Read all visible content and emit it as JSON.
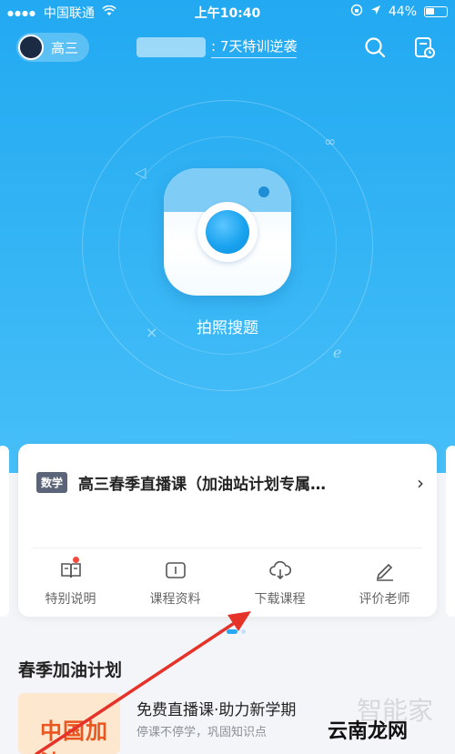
{
  "status_bar": {
    "carrier": "中国联通",
    "time": "上午10:40",
    "battery": "44%"
  },
  "header": {
    "grade": "高三",
    "countdown_text": ": 7天特训逆袭"
  },
  "camera": {
    "label": "拍照搜题"
  },
  "course_card": {
    "subject_tag": "数学",
    "title": "高三春季直播课（加油站计划专属…",
    "actions": [
      {
        "label": "特别说明",
        "icon": "book-icon"
      },
      {
        "label": "课程资料",
        "icon": "book-open-icon"
      },
      {
        "label": "下载课程",
        "icon": "cloud-download-icon"
      },
      {
        "label": "评价老师",
        "icon": "pencil-icon"
      }
    ]
  },
  "section": {
    "title": "春季加油计划"
  },
  "promo": {
    "image_text": "中国加油",
    "title": "免费直播课·助力新学期",
    "subtitle": "停课不停学，巩固知识点"
  },
  "watermark": {
    "text": "云南龙网",
    "light_text": "智能家"
  },
  "colors": {
    "hero_blue": "#22a9f1",
    "accent_red": "#f24b3c",
    "annotation_arrow": "#e6332a"
  }
}
